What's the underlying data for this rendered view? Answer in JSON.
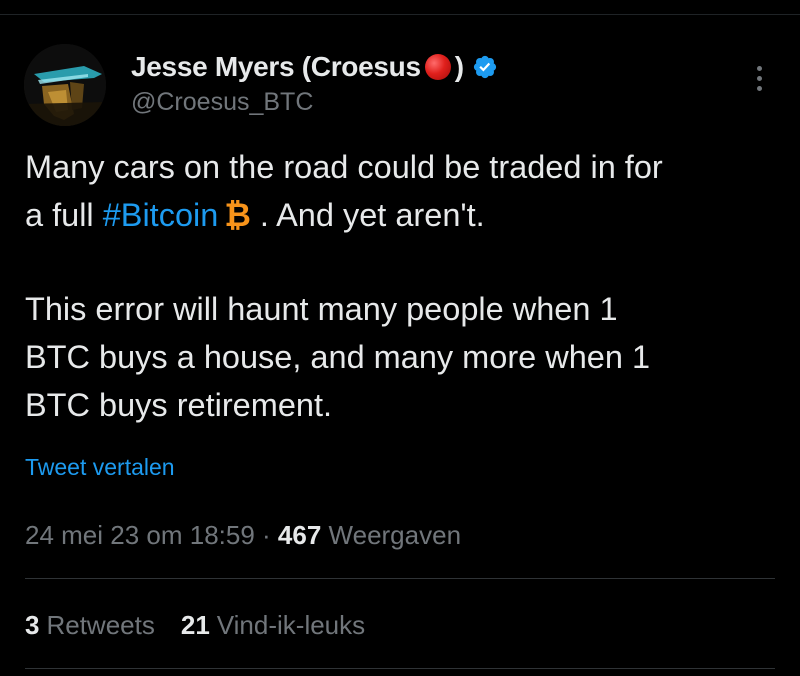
{
  "author": {
    "display_name": "Jesse Myers (Croesus",
    "name_suffix": ")",
    "handle": "@Croesus_BTC",
    "avatar_icon": "avatar-image",
    "verified_icon": "verified-badge-icon",
    "red_circle_emoji": "red-circle-emoji"
  },
  "tweet": {
    "line1": "Many cars on the road could be traded in for",
    "line2_prefix": "a full ",
    "hashtag": "#Bitcoin",
    "btc_symbol": "₿",
    "line2_suffix": " .  And yet aren't.",
    "para2_line1": "This error will haunt many people when 1",
    "para2_line2": "BTC buys a house, and many more when 1",
    "para2_line3": "BTC buys retirement."
  },
  "translate_label": "Tweet vertalen",
  "meta": {
    "timestamp": "24 mei 23 om 18:59",
    "separator": " · ",
    "views_count": "467",
    "views_label": " Weergaven"
  },
  "stats": {
    "retweets_count": "3",
    "retweets_label": "Retweets",
    "likes_count": "21",
    "likes_label": "Vind-ik-leuks"
  },
  "colors": {
    "background": "#000000",
    "text": "#e7e9ea",
    "secondary": "#71767b",
    "link": "#1d9bf0",
    "bitcoin": "#f7931a",
    "verified": "#1d9bf0"
  }
}
